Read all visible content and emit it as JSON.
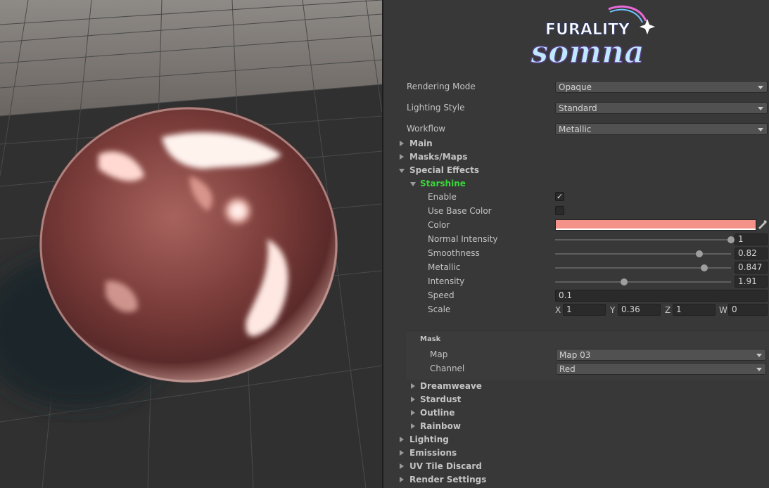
{
  "logo": {
    "top_text": "FURALITY",
    "bottom_text": "somna"
  },
  "top_settings": [
    {
      "label": "Rendering Mode",
      "value": "Opaque"
    },
    {
      "label": "Lighting Style",
      "value": "Standard"
    },
    {
      "label": "Workflow",
      "value": "Metallic"
    }
  ],
  "sections": {
    "main": "Main",
    "masks_maps": "Masks/Maps",
    "special_effects": "Special Effects",
    "starshine": "Starshine",
    "dreamweave": "Dreamweave",
    "stardust": "Stardust",
    "outline": "Outline",
    "rainbow": "Rainbow",
    "lighting": "Lighting",
    "emissions": "Emissions",
    "uv_tile_discard": "UV Tile Discard",
    "render_settings": "Render Settings"
  },
  "starshine": {
    "enable": {
      "label": "Enable",
      "checked": true,
      "glyph": "✓"
    },
    "use_base_color": {
      "label": "Use Base Color",
      "checked": false
    },
    "color": {
      "label": "Color",
      "value": "#f4928a"
    },
    "normal_intensity": {
      "label": "Normal Intensity",
      "value": "1",
      "fraction": 1.0
    },
    "smoothness": {
      "label": "Smoothness",
      "value": "0.82",
      "fraction": 0.82
    },
    "metallic": {
      "label": "Metallic",
      "value": "0.847",
      "fraction": 0.847
    },
    "intensity": {
      "label": "Intensity",
      "value": "1.91",
      "fraction": 0.39
    },
    "speed": {
      "label": "Speed",
      "value": "0.1"
    },
    "scale": {
      "label": "Scale",
      "x_label": "X",
      "x": "1",
      "y_label": "Y",
      "y": "0.36",
      "z_label": "Z",
      "z": "1",
      "w_label": "W",
      "w": "0"
    }
  },
  "mask": {
    "header": "Mask",
    "map_label": "Map",
    "map_value": "Map 03",
    "channel_label": "Channel",
    "channel_value": "Red"
  },
  "colors": {
    "accent_green": "#3bd63b",
    "inspector_bg": "#383838",
    "sphere_tint": "#a05c58"
  }
}
